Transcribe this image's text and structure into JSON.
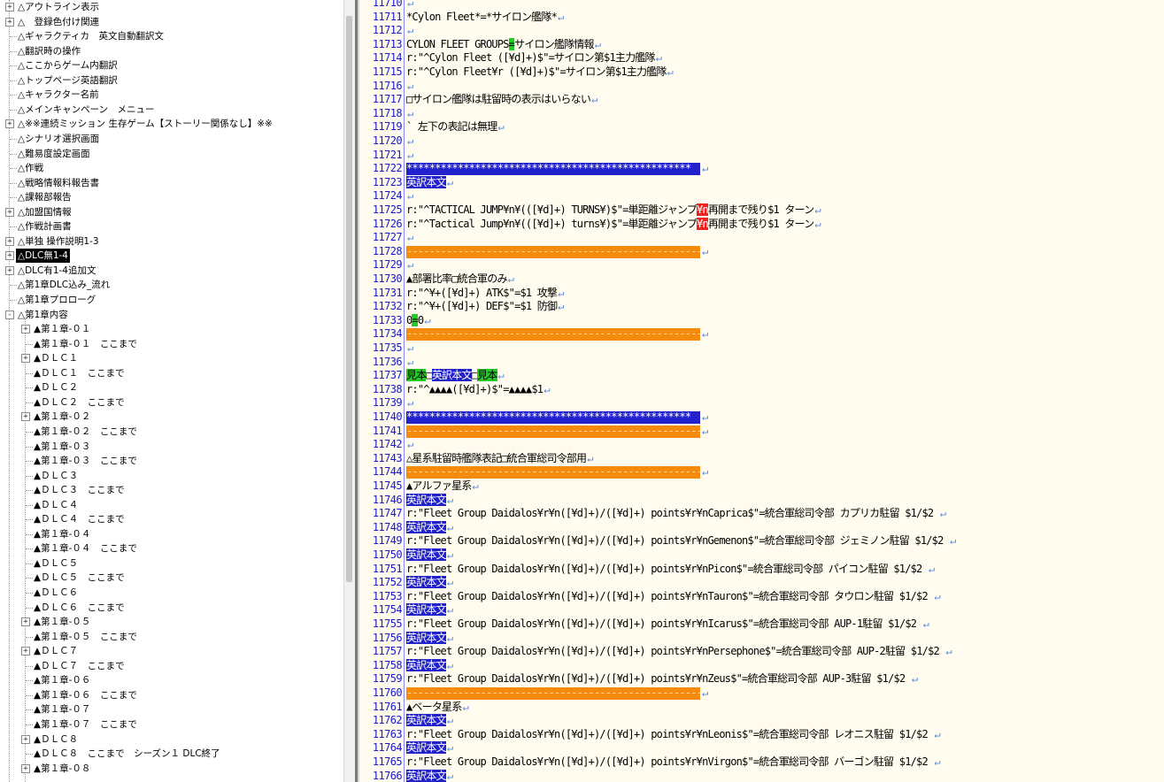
{
  "tree": {
    "items": [
      {
        "label": "△アウトライン表示",
        "level": 0,
        "expander": "+"
      },
      {
        "label": "△　登録色付け関連",
        "level": 0,
        "expander": "+"
      },
      {
        "label": "△ギャラクティカ　英文自動翻訳文",
        "level": 0,
        "expander": ""
      },
      {
        "label": "△翻訳時の操作",
        "level": 0,
        "expander": ""
      },
      {
        "label": "△ここからゲーム内翻訳",
        "level": 0,
        "expander": ""
      },
      {
        "label": "△トップページ英語翻訳",
        "level": 0,
        "expander": ""
      },
      {
        "label": "△キャラクター名前",
        "level": 0,
        "expander": ""
      },
      {
        "label": "△メインキャンペーン　メニュー",
        "level": 0,
        "expander": ""
      },
      {
        "label": "△※※連続ミッション 生存ゲーム【ストーリー関係なし】※※",
        "level": 0,
        "expander": "+"
      },
      {
        "label": "△シナリオ選択画面",
        "level": 0,
        "expander": ""
      },
      {
        "label": "△難易度設定画面",
        "level": 0,
        "expander": ""
      },
      {
        "label": "△作戦",
        "level": 0,
        "expander": ""
      },
      {
        "label": "△戦略情報料報告書",
        "level": 0,
        "expander": ""
      },
      {
        "label": "△課報部報告",
        "level": 0,
        "expander": ""
      },
      {
        "label": "△加盟国情報",
        "level": 0,
        "expander": "+"
      },
      {
        "label": "△作戦計画書",
        "level": 0,
        "expander": ""
      },
      {
        "label": "△単独 操作説明1-3",
        "level": 0,
        "expander": "+"
      },
      {
        "label": "△DLC無1-4",
        "level": 0,
        "expander": "+",
        "selected": true
      },
      {
        "label": "△DLC有1-4追加文",
        "level": 0,
        "expander": "+"
      },
      {
        "label": "△第1章DLC込み_流れ",
        "level": 0,
        "expander": ""
      },
      {
        "label": "△第1章プロローグ",
        "level": 0,
        "expander": ""
      },
      {
        "label": "△第1章内容",
        "level": 0,
        "expander": "-"
      },
      {
        "label": "▲第１章-０１",
        "level": 1,
        "expander": "+"
      },
      {
        "label": "▲第１章-０１　ここまで",
        "level": 1,
        "expander": ""
      },
      {
        "label": "▲ＤＬＣ１",
        "level": 1,
        "expander": "+"
      },
      {
        "label": "▲ＤＬＣ１　ここまで",
        "level": 1,
        "expander": ""
      },
      {
        "label": "▲ＤＬＣ２",
        "level": 1,
        "expander": ""
      },
      {
        "label": "▲ＤＬＣ２　ここまで",
        "level": 1,
        "expander": ""
      },
      {
        "label": "▲第１章-０２",
        "level": 1,
        "expander": "+"
      },
      {
        "label": "▲第１章-０２　ここまで",
        "level": 1,
        "expander": ""
      },
      {
        "label": "▲第１章-０３",
        "level": 1,
        "expander": ""
      },
      {
        "label": "▲第１章-０３　ここまで",
        "level": 1,
        "expander": ""
      },
      {
        "label": "▲ＤＬＣ３",
        "level": 1,
        "expander": ""
      },
      {
        "label": "▲ＤＬＣ３　ここまで",
        "level": 1,
        "expander": ""
      },
      {
        "label": "▲ＤＬＣ４",
        "level": 1,
        "expander": ""
      },
      {
        "label": "▲ＤＬＣ４　ここまで",
        "level": 1,
        "expander": ""
      },
      {
        "label": "▲第１章-０４",
        "level": 1,
        "expander": ""
      },
      {
        "label": "▲第１章-０４　ここまで",
        "level": 1,
        "expander": ""
      },
      {
        "label": "▲ＤＬＣ５",
        "level": 1,
        "expander": ""
      },
      {
        "label": "▲ＤＬＣ５　ここまで",
        "level": 1,
        "expander": ""
      },
      {
        "label": "▲ＤＬＣ６",
        "level": 1,
        "expander": ""
      },
      {
        "label": "▲ＤＬＣ６　ここまで",
        "level": 1,
        "expander": ""
      },
      {
        "label": "▲第１章-０５",
        "level": 1,
        "expander": "+"
      },
      {
        "label": "▲第１章-０５　ここまで",
        "level": 1,
        "expander": ""
      },
      {
        "label": "▲ＤＬＣ７",
        "level": 1,
        "expander": "+"
      },
      {
        "label": "▲ＤＬＣ７　ここまで",
        "level": 1,
        "expander": ""
      },
      {
        "label": "▲第１章-０６",
        "level": 1,
        "expander": ""
      },
      {
        "label": "▲第１章-０６　ここまで",
        "level": 1,
        "expander": ""
      },
      {
        "label": "▲第１章-０７",
        "level": 1,
        "expander": ""
      },
      {
        "label": "▲第１章-０７　ここまで",
        "level": 1,
        "expander": ""
      },
      {
        "label": "▲ＤＬＣ８",
        "level": 1,
        "expander": "+"
      },
      {
        "label": "▲ＤＬＣ８　ここまで　シーズン１ DLC終了",
        "level": 1,
        "expander": ""
      },
      {
        "label": "▲第１章-０８",
        "level": 1,
        "expander": "+"
      }
    ]
  },
  "editor": {
    "colors": {
      "blue": "#2222cc",
      "orange": "#f58b0c",
      "green": "#22cc22",
      "red": "#ee2222",
      "line_number": "#1a1acc",
      "background": "#fffbee"
    },
    "eol_mark": "↵",
    "lines": [
      {
        "num": "11710",
        "segs": [
          {
            "t": ""
          }
        ]
      },
      {
        "num": "11711",
        "segs": [
          {
            "t": "*Cylon Fleet*=*サイロン艦隊*"
          }
        ]
      },
      {
        "num": "11712",
        "segs": [
          {
            "t": ""
          }
        ]
      },
      {
        "num": "11713",
        "segs": [
          {
            "t": "CYLON FLEET GROUPS"
          },
          {
            "t": "=",
            "hl": "green"
          },
          {
            "t": "サイロン艦隊情報"
          }
        ]
      },
      {
        "num": "11714",
        "segs": [
          {
            "t": "r:\"^Cylon Fleet ([¥d]+)$\"=サイロン第$1主力艦隊"
          }
        ]
      },
      {
        "num": "11715",
        "segs": [
          {
            "t": "r:\"^Cylon Fleet¥r ([¥d]+)$\"=サイロン第$1主力艦隊"
          }
        ]
      },
      {
        "num": "11716",
        "segs": [
          {
            "t": ""
          }
        ]
      },
      {
        "num": "11717",
        "segs": [
          {
            "t": "□サイロン艦隊は駐留時の表示はいらない"
          }
        ]
      },
      {
        "num": "11718",
        "segs": [
          {
            "t": ""
          }
        ]
      },
      {
        "num": "11719",
        "segs": [
          {
            "t": "`    左下の表記は無理"
          }
        ]
      },
      {
        "num": "11720",
        "segs": [
          {
            "t": ""
          }
        ]
      },
      {
        "num": "11721",
        "segs": [
          {
            "t": ""
          }
        ]
      },
      {
        "num": "11722",
        "bar": "blue",
        "bartext": "**************************************************"
      },
      {
        "num": "11723",
        "segs": [
          {
            "t": "英訳本文",
            "hl": "blue"
          }
        ]
      },
      {
        "num": "11724",
        "segs": [
          {
            "t": ""
          }
        ]
      },
      {
        "num": "11725",
        "segs": [
          {
            "t": "r:\"^TACTICAL JUMP¥n¥(([¥d]+) TURNS¥)$\"=単距離ジャンプ"
          },
          {
            "t": "¥n",
            "hl": "red"
          },
          {
            "t": "再開まで残り$1 ターン"
          }
        ]
      },
      {
        "num": "11726",
        "segs": [
          {
            "t": "r:\"^Tactical Jump¥n¥(([¥d]+) turns¥)$\"=単距離ジャンプ"
          },
          {
            "t": "¥n",
            "hl": "red"
          },
          {
            "t": "再開まで残り$1 ターン"
          }
        ]
      },
      {
        "num": "11727",
        "segs": [
          {
            "t": ""
          }
        ]
      },
      {
        "num": "11728",
        "bar": "orange",
        "bartext": "--------------------------------------------------------"
      },
      {
        "num": "11729",
        "segs": [
          {
            "t": ""
          }
        ]
      },
      {
        "num": "11730",
        "segs": [
          {
            "t": "▲部署比率□統合軍のみ"
          }
        ]
      },
      {
        "num": "11731",
        "segs": [
          {
            "t": "r:\"^¥+([¥d]+) ATK$\"=$1 攻撃"
          }
        ]
      },
      {
        "num": "11732",
        "segs": [
          {
            "t": "r:\"^¥+([¥d]+) DEF$\"=$1 防御"
          }
        ]
      },
      {
        "num": "11733",
        "segs": [
          {
            "t": "0"
          },
          {
            "t": "=",
            "hl": "green"
          },
          {
            "t": "0"
          }
        ]
      },
      {
        "num": "11734",
        "bar": "orange",
        "bartext": "--------------------------------------------------------"
      },
      {
        "num": "11735",
        "segs": [
          {
            "t": ""
          }
        ]
      },
      {
        "num": "11736",
        "segs": [
          {
            "t": ""
          }
        ]
      },
      {
        "num": "11737",
        "segs": [
          {
            "t": "見本",
            "hl": "green"
          },
          {
            "t": "□"
          },
          {
            "t": "英訳本文",
            "hl": "blue"
          },
          {
            "t": "□"
          },
          {
            "t": "見本",
            "hl": "green"
          }
        ]
      },
      {
        "num": "11738",
        "segs": [
          {
            "t": "r:\"^▲▲▲▲([¥d]+)$\"=▲▲▲▲$1"
          }
        ]
      },
      {
        "num": "11739",
        "segs": [
          {
            "t": ""
          }
        ]
      },
      {
        "num": "11740",
        "bar": "blue",
        "bartext": "**************************************************"
      },
      {
        "num": "11741",
        "bar": "orange",
        "bartext": "--------------------------------------------------------"
      },
      {
        "num": "11742",
        "segs": [
          {
            "t": ""
          }
        ]
      },
      {
        "num": "11743",
        "segs": [
          {
            "t": "△星系駐留時艦隊表記□統合軍総司令部用"
          }
        ]
      },
      {
        "num": "11744",
        "bar": "orange",
        "bartext": "--------------------------------------------------------"
      },
      {
        "num": "11745",
        "segs": [
          {
            "t": "▲アルファ星系"
          }
        ]
      },
      {
        "num": "11746",
        "segs": [
          {
            "t": "英訳本文",
            "hl": "blue"
          }
        ]
      },
      {
        "num": "11747",
        "segs": [
          {
            "t": "r:\"Fleet Group Daidalos¥r¥n([¥d]+)/([¥d]+) points¥r¥nCaprica$\"=統合軍総司令部 カプリカ駐留 $1/$2 "
          }
        ]
      },
      {
        "num": "11748",
        "segs": [
          {
            "t": "英訳本文",
            "hl": "blue"
          }
        ]
      },
      {
        "num": "11749",
        "segs": [
          {
            "t": "r:\"Fleet Group Daidalos¥r¥n([¥d]+)/([¥d]+) points¥r¥nGemenon$\"=統合軍総司令部 ジェミノン駐留 $1/$2 "
          }
        ]
      },
      {
        "num": "11750",
        "segs": [
          {
            "t": "英訳本文",
            "hl": "blue"
          }
        ]
      },
      {
        "num": "11751",
        "segs": [
          {
            "t": "r:\"Fleet Group Daidalos¥r¥n([¥d]+)/([¥d]+) points¥r¥nPicon$\"=統合軍総司令部 パイコン駐留 $1/$2 "
          }
        ]
      },
      {
        "num": "11752",
        "segs": [
          {
            "t": "英訳本文",
            "hl": "blue"
          }
        ]
      },
      {
        "num": "11753",
        "segs": [
          {
            "t": "r:\"Fleet Group Daidalos¥r¥n([¥d]+)/([¥d]+) points¥r¥nTauron$\"=統合軍総司令部 タウロン駐留 $1/$2 "
          }
        ]
      },
      {
        "num": "11754",
        "segs": [
          {
            "t": "英訳本文",
            "hl": "blue"
          }
        ]
      },
      {
        "num": "11755",
        "segs": [
          {
            "t": "r:\"Fleet Group Daidalos¥r¥n([¥d]+)/([¥d]+) points¥r¥nIcarus$\"=統合軍総司令部 AUP-1駐留 $1/$2 "
          }
        ]
      },
      {
        "num": "11756",
        "segs": [
          {
            "t": "英訳本文",
            "hl": "blue"
          }
        ]
      },
      {
        "num": "11757",
        "segs": [
          {
            "t": "r:\"Fleet Group Daidalos¥r¥n([¥d]+)/([¥d]+) points¥r¥nPersephone$\"=統合軍総司令部 AUP-2駐留 $1/$2 "
          }
        ]
      },
      {
        "num": "11758",
        "segs": [
          {
            "t": "英訳本文",
            "hl": "blue"
          }
        ]
      },
      {
        "num": "11759",
        "segs": [
          {
            "t": "r:\"Fleet Group Daidalos¥r¥n([¥d]+)/([¥d]+) points¥r¥nZeus$\"=統合軍総司令部 AUP-3駐留 $1/$2 "
          }
        ]
      },
      {
        "num": "11760",
        "bar": "orange",
        "bartext": "--------------------------------------------------------"
      },
      {
        "num": "11761",
        "segs": [
          {
            "t": "▲ベータ星系"
          }
        ]
      },
      {
        "num": "11762",
        "segs": [
          {
            "t": "英訳本文",
            "hl": "blue"
          }
        ]
      },
      {
        "num": "11763",
        "segs": [
          {
            "t": "r:\"Fleet Group Daidalos¥r¥n([¥d]+)/([¥d]+) points¥r¥nLeonis$\"=統合軍総司令部 レオニス駐留 $1/$2 "
          }
        ]
      },
      {
        "num": "11764",
        "segs": [
          {
            "t": "英訳本文",
            "hl": "blue"
          }
        ]
      },
      {
        "num": "11765",
        "segs": [
          {
            "t": "r:\"Fleet Group Daidalos¥r¥n([¥d]+)/([¥d]+) points¥r¥nVirgon$\"=統合軍総司令部 バーゴン駐留 $1/$2 "
          }
        ]
      },
      {
        "num": "11766",
        "segs": [
          {
            "t": "英訳本文",
            "hl": "blue"
          }
        ]
      }
    ]
  }
}
